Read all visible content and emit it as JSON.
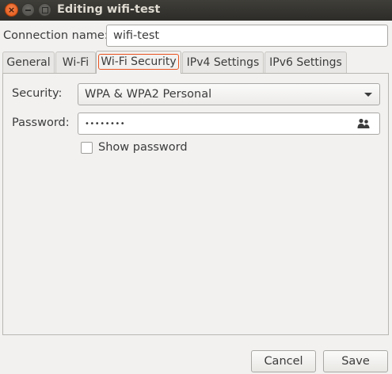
{
  "window": {
    "title": "Editing wifi-test",
    "close_glyph": "×"
  },
  "connection": {
    "label": "Connection name:",
    "value": "wifi-test"
  },
  "tabs": [
    {
      "label": "General"
    },
    {
      "label": "Wi-Fi"
    },
    {
      "label": "Wi-Fi Security",
      "active": true
    },
    {
      "label": "IPv4 Settings"
    },
    {
      "label": "IPv6 Settings"
    }
  ],
  "security": {
    "label": "Security:",
    "selected": "WPA & WPA2 Personal"
  },
  "password": {
    "label": "Password:",
    "masked_value": "••••••••",
    "icon": "users-icon"
  },
  "show_password": {
    "label": "Show password",
    "checked": false
  },
  "buttons": {
    "cancel": "Cancel",
    "save": "Save"
  },
  "colors": {
    "accent": "#e95420",
    "titlebar": "#3c3b37",
    "background": "#f2f1f0"
  }
}
